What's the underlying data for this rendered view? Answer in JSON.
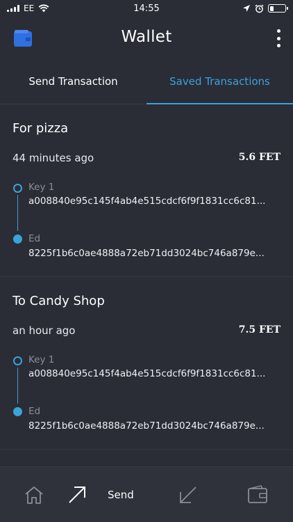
{
  "status_bar": {
    "carrier": "EE",
    "time": "14:55"
  },
  "header": {
    "title": "Wallet"
  },
  "tabs": [
    {
      "label": "Send Transaction",
      "active": false
    },
    {
      "label": "Saved Transactions",
      "active": true
    }
  ],
  "transactions": [
    {
      "title": "For pizza",
      "time": "44 minutes ago",
      "amount": "5.6 FET",
      "from_label": "Key 1",
      "from_hash": "a008840e95c145f4ab4e515cdcf6f9f1831cc6c81...",
      "to_label": "Ed",
      "to_hash": "8225f1b6c0ae4888a72eb71dd3024bc746a879e..."
    },
    {
      "title": "To Candy Shop",
      "time": "an hour ago",
      "amount": "7.5 FET",
      "from_label": "Key 1",
      "from_hash": "a008840e95c145f4ab4e515cdcf6f9f1831cc6c81...",
      "to_label": "Ed",
      "to_hash": "8225f1b6c0ae4888a72eb71dd3024bc746a879e..."
    }
  ],
  "bottom_nav": {
    "home_icon": "home-icon",
    "send_label": "Send",
    "receive_icon": "arrow-down-left-icon",
    "wallet_icon": "wallet-icon"
  },
  "colors": {
    "accent": "#3aa3dc",
    "background": "#2a2c36",
    "nav_background": "#2f313b"
  }
}
